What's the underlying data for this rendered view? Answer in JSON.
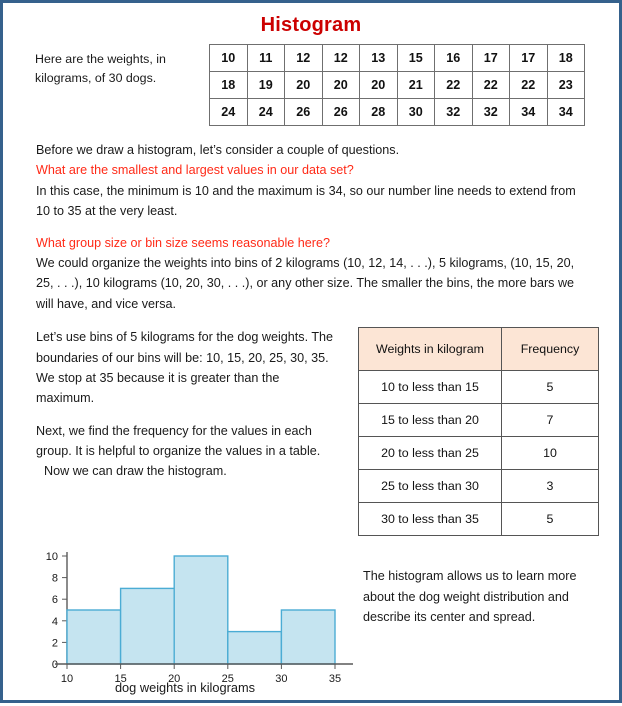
{
  "title": "Histogram",
  "intro": {
    "text": "Here are the weights, in kilograms, of 30 dogs."
  },
  "data_table": {
    "rows": [
      [
        "10",
        "11",
        "12",
        "12",
        "13",
        "15",
        "16",
        "17",
        "17",
        "18"
      ],
      [
        "18",
        "19",
        "20",
        "20",
        "20",
        "21",
        "22",
        "22",
        "22",
        "23"
      ],
      [
        "24",
        "24",
        "26",
        "26",
        "28",
        "30",
        "32",
        "32",
        "34",
        "34"
      ]
    ]
  },
  "body": {
    "line1": "Before we draw a histogram, let’s consider a couple of questions.",
    "question1": "What are the smallest and largest values in our data set?",
    "answer1": "In this case, the minimum  is 10 and the maximum  is 34, so our  number  line needs to extend  from  10 to 35 at the very least.",
    "question2": "What group size or bin size seems reasonable here?",
    "answer2": "We could organize the weights into bins of 2 kilograms (10, 12, 14, . . .), 5 kilograms, (10, 15, 20, 25, . . .), 10 kilograms (10, 20, 30, . . .), or any other size. The smaller the bins, the more bars we will have, and vice versa."
  },
  "left_column": {
    "para1": "Let’s use bins of 5 kilograms for the dog weights. The boundaries of our bins will be: 10, 15, 20, 25, 30, 35. We stop at 35 because it is greater than the maximum.",
    "para2": "Next, we find the frequency for the values in each group.  It is helpful to organize the values in a table.",
    "para3": "Now we can draw the histogram."
  },
  "freq_table": {
    "headers": [
      "Weights in kilogram",
      "Frequency"
    ],
    "rows": [
      [
        "10 to less than 15",
        "5"
      ],
      [
        "15 to less than 20",
        "7"
      ],
      [
        "20 to less than 25",
        "10"
      ],
      [
        "25 to less than 30",
        "3"
      ],
      [
        "30 to less than 35",
        "5"
      ]
    ]
  },
  "closing": {
    "text": "The histogram allows us to learn more about the dog weight distribution and describe its center and spread."
  },
  "colors": {
    "border": "#35618c",
    "title": "#cc0000",
    "question": "#ff2a17",
    "bar_fill": "#c5e4f0",
    "bar_stroke": "#4bacd4",
    "table_header": "#fce5d5",
    "axis": "#595959"
  },
  "chart_data": {
    "type": "bar",
    "title": "",
    "xlabel": "dog weights in kilograms",
    "ylabel": "",
    "categories": [
      "10",
      "15",
      "20",
      "25",
      "30",
      "35"
    ],
    "bin_edges": [
      10,
      15,
      20,
      25,
      30,
      35
    ],
    "values": [
      5,
      7,
      10,
      3,
      5
    ],
    "bin_labels": [
      "10 to less than 15",
      "15 to less than 20",
      "20 to less than 25",
      "25 to less than 30",
      "30 to less than 35"
    ],
    "xlim": [
      10,
      35
    ],
    "ylim": [
      0,
      10
    ],
    "yticks": [
      0,
      2,
      4,
      6,
      8,
      10
    ],
    "xticks": [
      10,
      15,
      20,
      25,
      30,
      35
    ],
    "grid": false,
    "legend": null
  }
}
